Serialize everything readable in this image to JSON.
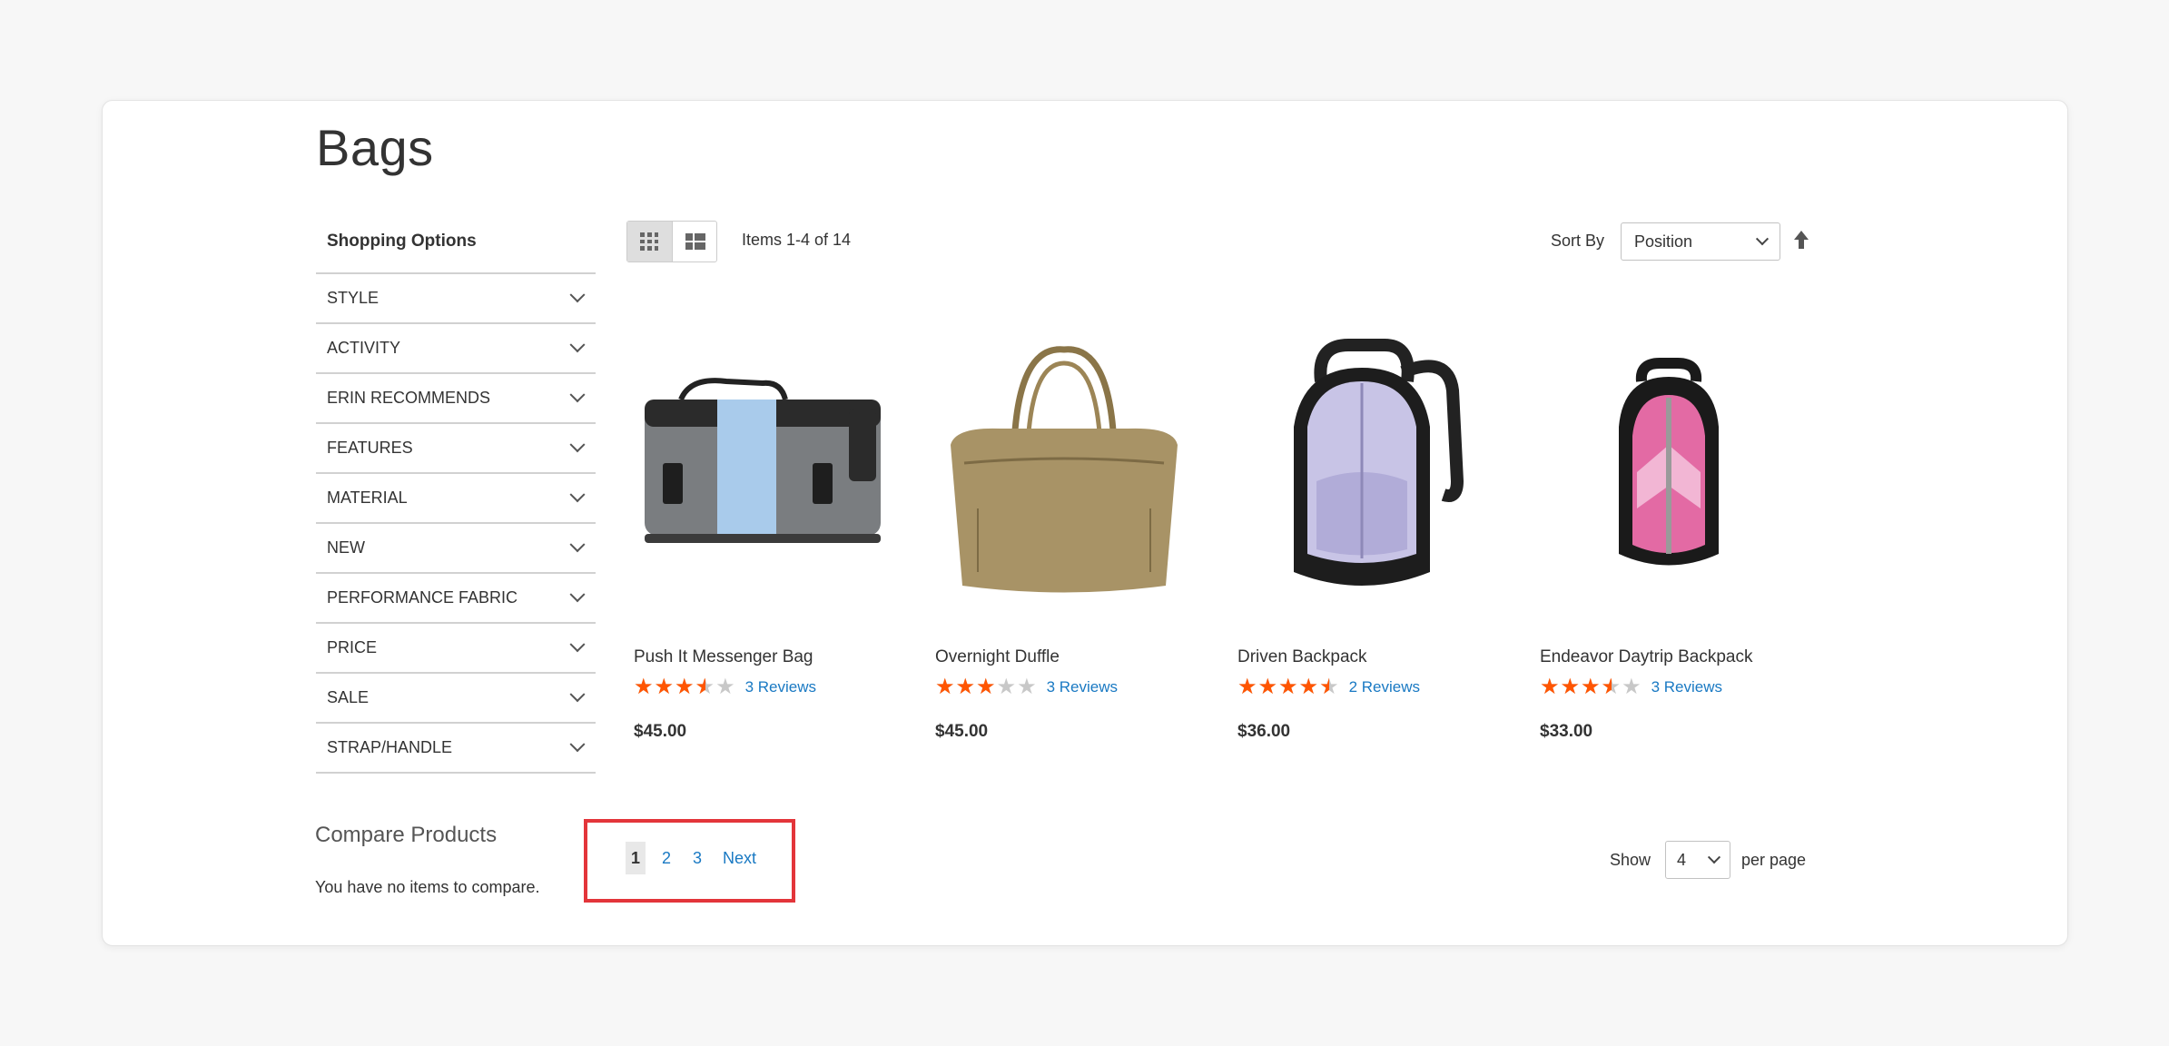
{
  "page": {
    "title": "Bags"
  },
  "sidebar": {
    "title": "Shopping Options",
    "filters": [
      {
        "label": "STYLE"
      },
      {
        "label": "ACTIVITY"
      },
      {
        "label": "ERIN RECOMMENDS"
      },
      {
        "label": "FEATURES"
      },
      {
        "label": "MATERIAL"
      },
      {
        "label": "NEW"
      },
      {
        "label": "PERFORMANCE FABRIC"
      },
      {
        "label": "PRICE"
      },
      {
        "label": "SALE"
      },
      {
        "label": "STRAP/HANDLE"
      }
    ]
  },
  "compare": {
    "title": "Compare Products",
    "empty_text": "You have no items to compare."
  },
  "toolbar": {
    "items_count": "Items 1-4 of 14",
    "sort_label": "Sort By",
    "sort_value": "Position",
    "view_modes": [
      "grid-icon",
      "list-icon"
    ]
  },
  "products": [
    {
      "name": "Push It Messenger Bag",
      "rating_percent": 70,
      "reviews": "3 Reviews",
      "price": "$45.00"
    },
    {
      "name": "Overnight Duffle",
      "rating_percent": 60,
      "reviews": "3 Reviews",
      "price": "$45.00"
    },
    {
      "name": "Driven Backpack",
      "rating_percent": 90,
      "reviews": "2 Reviews",
      "price": "$36.00"
    },
    {
      "name": "Endeavor Daytrip Backpack",
      "rating_percent": 70,
      "reviews": "3 Reviews",
      "price": "$33.00"
    }
  ],
  "pagination": {
    "pages": [
      "1",
      "2",
      "3"
    ],
    "current": "1",
    "next_label": "Next"
  },
  "limiter": {
    "show_label": "Show",
    "value": "4",
    "per_page_label": "per page"
  },
  "colors": {
    "star": "#ff5501",
    "link": "#1979c3",
    "highlight": "#e3353a"
  }
}
